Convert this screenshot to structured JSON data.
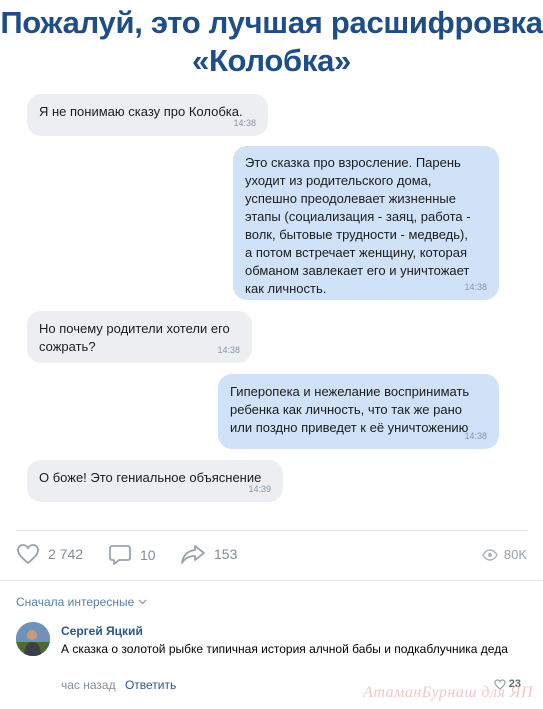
{
  "header": {
    "title_line1": "Пожалуй, это лучшая расшифровка",
    "title_line2": "«Колобка»"
  },
  "messages": [
    {
      "side": "in",
      "lines": [
        "Я не понимаю сказу про Колобка."
      ],
      "time": "14:38"
    },
    {
      "side": "out",
      "lines": [
        "Это сказка про взросление. Парень",
        "уходит из родительского дома,",
        "успешно преодолевает жизненные",
        "этапы (социализация - заяц, работа -",
        "волк, бытовые трудности - медведь),",
        "а потом встречает женщину, которая",
        "обманом завлекает его и уничтожает",
        "как личность."
      ],
      "time": "14:38"
    },
    {
      "side": "in",
      "lines": [
        "Но почему родители хотели его",
        "сожрать?"
      ],
      "time": "14:38"
    },
    {
      "side": "out",
      "lines": [
        "Гиперопека и нежелание воспринимать",
        "ребенка как личность, что так же рано",
        "или поздно приведет к её уничтожению"
      ],
      "time": "14:38"
    },
    {
      "side": "in",
      "lines": [
        "О боже! Это гениальное объяснение"
      ],
      "time": "14:39"
    }
  ],
  "actions": {
    "likes": "2 742",
    "comments": "10",
    "shares": "153",
    "views": "80K"
  },
  "comments_section": {
    "sort_label": "Сначала интересные",
    "comment": {
      "author": "Сергей Яцкий",
      "text": "А сказка о золотой рыбке типичная история алчной бабы и подкаблучника деда",
      "time": "час назад",
      "reply_label": "Ответить",
      "likes": "23"
    }
  },
  "watermark": "АтаманБурнаш для ЯП",
  "colors": {
    "title": "#1f4d87",
    "incoming_bubble": "#eceef1",
    "outgoing_bubble": "#cfe2f8",
    "link": "#2a5885"
  }
}
